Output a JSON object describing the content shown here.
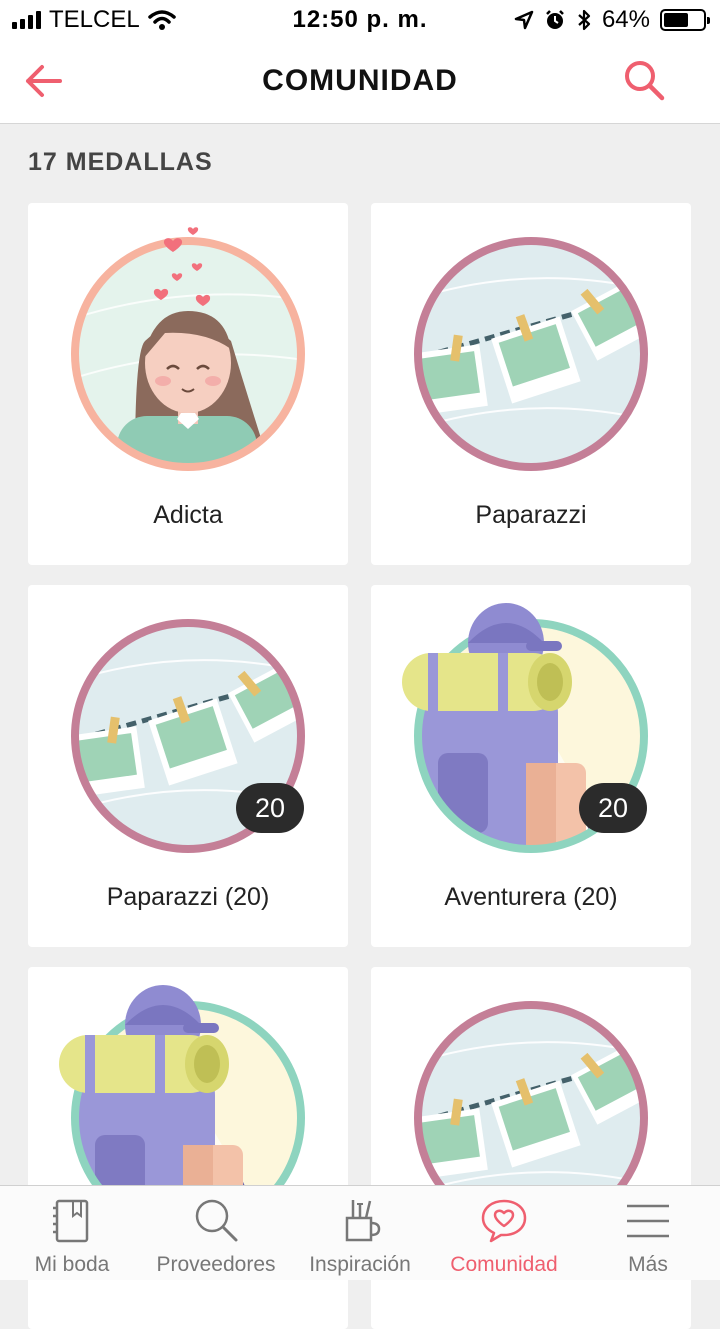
{
  "status_bar": {
    "carrier": "TELCEL",
    "time": "12:50 p. m.",
    "battery": "64%",
    "battery_level": 0.64
  },
  "header": {
    "title": "COMUNIDAD",
    "back_icon": "arrow-left-icon",
    "search_icon": "search-icon"
  },
  "section": {
    "title": "17 MEDALLAS"
  },
  "medals": [
    {
      "label": "Adicta",
      "icon": "girl-medal"
    },
    {
      "label": "Paparazzi",
      "icon": "photos-medal"
    },
    {
      "label": "Paparazzi (20)",
      "icon": "photos-medal",
      "count": "20"
    },
    {
      "label": "Aventurera (20)",
      "icon": "backpack-medal",
      "count": "20"
    },
    {
      "label": "",
      "icon": "backpack-medal"
    },
    {
      "label": "",
      "icon": "photos-medal"
    }
  ],
  "tabs": [
    {
      "label": "Mi boda",
      "icon": "notebook-icon"
    },
    {
      "label": "Proveedores",
      "icon": "search-icon"
    },
    {
      "label": "Inspiración",
      "icon": "brushes-icon"
    },
    {
      "label": "Comunidad",
      "icon": "heart-bubble-icon",
      "active": true
    },
    {
      "label": "Más",
      "icon": "menu-icon"
    }
  ],
  "colors": {
    "accent": "#ef5f6f",
    "background": "#efefef",
    "badge": "#2b2b2b"
  }
}
